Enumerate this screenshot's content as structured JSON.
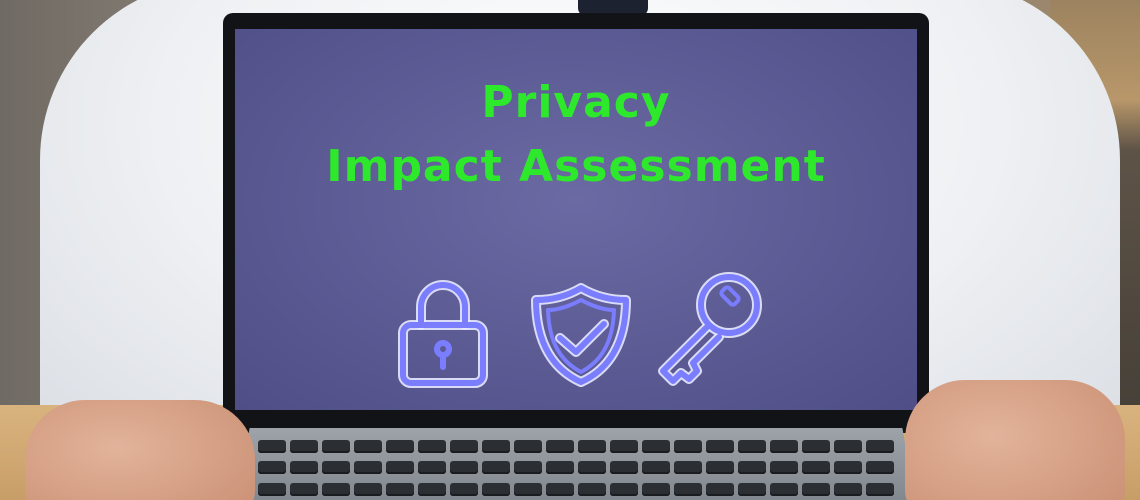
{
  "screen": {
    "title_line1": "Privacy",
    "title_line2": "Impact Assessment",
    "title_color": "#2ee82c",
    "background_color": "#5a5992",
    "icons": [
      "lock-icon",
      "shield-check-icon",
      "key-icon"
    ],
    "icon_color": "#7b7dff"
  },
  "scene": {
    "shirt_color": "#ffffff",
    "desk_color": "#d9b37e"
  }
}
